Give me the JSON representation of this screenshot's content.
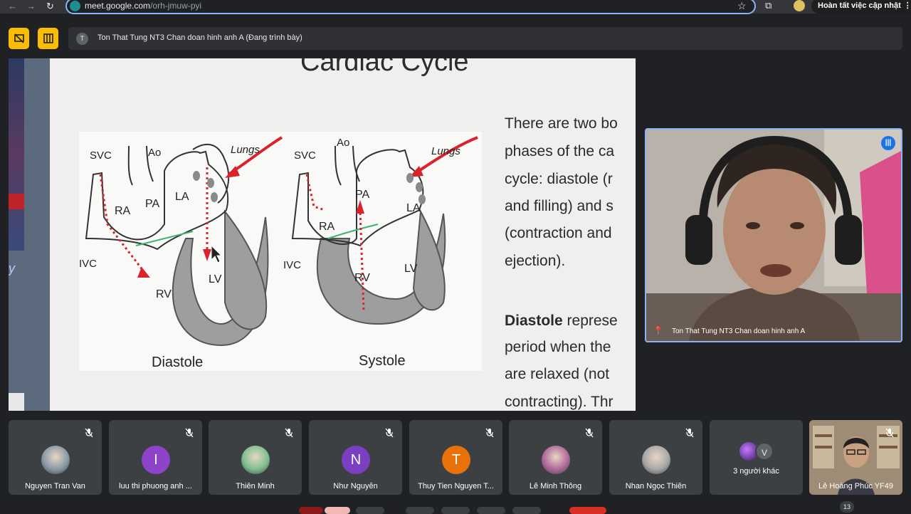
{
  "browser": {
    "url_domain": "meet.google.com",
    "url_path": "/orh-jmuw-pyi",
    "update_label": "Hoàn tất việc cập nhật",
    "kebab": "⋮"
  },
  "header": {
    "presenter_initial": "T",
    "presenting_text": "Ton That Tung NT3 Chan doan hinh anh A (Đang trình bày)"
  },
  "slide": {
    "title": "Cardiac Cycle",
    "paragraph_lines": [
      "There are two bo",
      "phases of the ca",
      "cycle: diastole (r",
      "and filling) and s",
      "(contraction and",
      "ejection)."
    ],
    "diastole_bold": "Diastole",
    "diastole_line1_rest": " represe",
    "diastole_lines": [
      "period when the",
      "are relaxed (not",
      "contracting). Thr"
    ],
    "diagram": {
      "left_caption": "Diastole",
      "right_caption": "Systole",
      "labels_left": [
        "SVC",
        "Ao",
        "Lungs",
        "RA",
        "PA",
        "LA",
        "IVC",
        "RV",
        "LV"
      ],
      "labels_right": [
        "SVC",
        "Ao",
        "Lungs",
        "PA",
        "LA",
        "RA",
        "IVC",
        "RV",
        "LV"
      ]
    }
  },
  "self_view": {
    "name": "Ton That Tung NT3 Chan doan hinh anh A"
  },
  "participants": [
    {
      "name": "Nguyen Tran Van",
      "avatar_type": "photo",
      "initial": "",
      "color": "#8a9aa6"
    },
    {
      "name": "luu thi phuong anh ...",
      "avatar_type": "letter",
      "initial": "I",
      "color": "#8e44c9"
    },
    {
      "name": "Thiên Minh",
      "avatar_type": "photo",
      "initial": "",
      "color": "#7fbf8f"
    },
    {
      "name": "Như Nguyễn",
      "avatar_type": "letter",
      "initial": "N",
      "color": "#7b3fc2"
    },
    {
      "name": "Thuy Tien Nguyen T...",
      "avatar_type": "letter",
      "initial": "T",
      "color": "#e8710a"
    },
    {
      "name": "Lê Minh Thông",
      "avatar_type": "photo",
      "initial": "",
      "color": "#b06a9a"
    },
    {
      "name": "Nhan Ngọc Thiên",
      "avatar_type": "photo",
      "initial": "",
      "color": "#a8a8a8"
    }
  ],
  "others": {
    "label": "3 người khác",
    "initial": "V"
  },
  "last_tile": {
    "name": "Lê Hoàng Phúc YF49"
  },
  "participant_count": "13"
}
